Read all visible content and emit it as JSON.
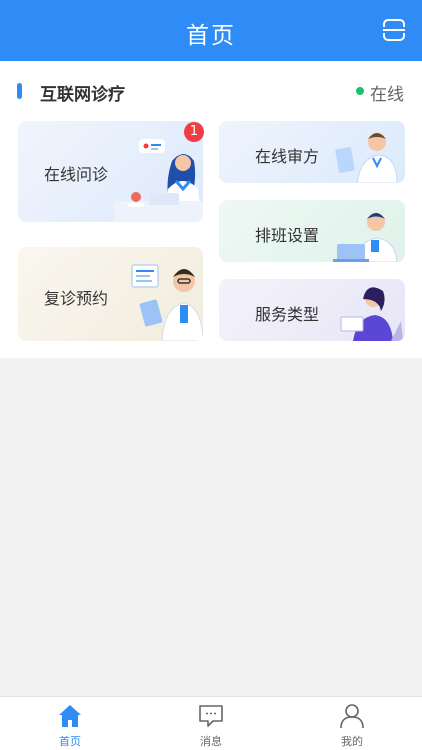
{
  "header": {
    "title": "首页",
    "scan_icon": "scan-icon"
  },
  "section": {
    "title": "互联网诊疗",
    "status": "在线",
    "status_color": "#21c06a"
  },
  "cards": {
    "consult": {
      "label": "在线问诊",
      "badge": "1"
    },
    "prescription_review": {
      "label": "在线审方"
    },
    "schedule": {
      "label": "排班设置"
    },
    "followup": {
      "label": "复诊预约"
    },
    "service_type": {
      "label": "服务类型"
    }
  },
  "tabbar": {
    "items": [
      {
        "label": "首页",
        "icon": "home-icon",
        "active": true
      },
      {
        "label": "消息",
        "icon": "message-icon",
        "active": false
      },
      {
        "label": "我的",
        "icon": "user-icon",
        "active": false
      }
    ]
  },
  "colors": {
    "primary": "#2f8cf6",
    "badge": "#ef3e43"
  }
}
